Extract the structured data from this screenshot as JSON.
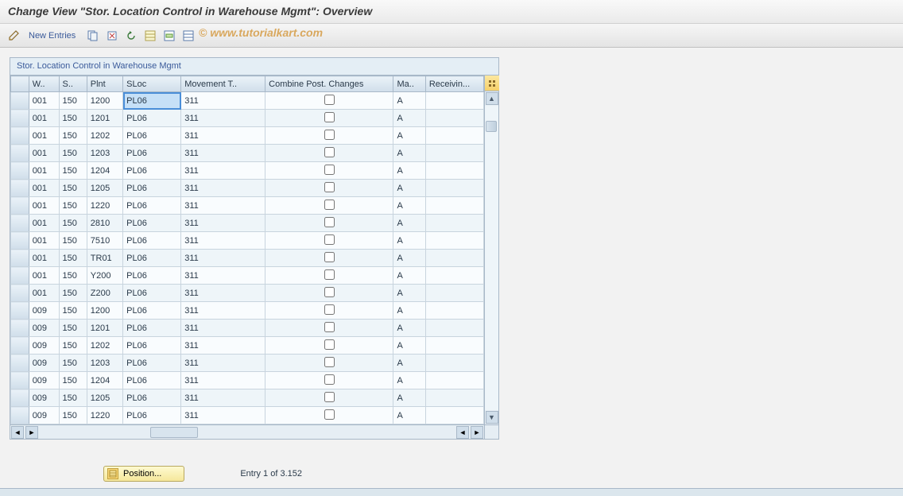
{
  "header": {
    "title": "Change View \"Stor. Location Control in Warehouse Mgmt\": Overview"
  },
  "toolbar": {
    "new_entries": "New Entries"
  },
  "watermark": "© www.tutorialkart.com",
  "panel": {
    "title": "Stor. Location Control in Warehouse Mgmt",
    "columns": {
      "w": "W..",
      "s": "S..",
      "plnt": "Plnt",
      "sloc": "SLoc",
      "movement": "Movement T..",
      "combine": "Combine Post. Changes",
      "ma": "Ma..",
      "receiving": "Receivin..."
    },
    "rows": [
      {
        "w": "001",
        "s": "150",
        "plnt": "1200",
        "sloc": "PL06",
        "mv": "311",
        "combine": false,
        "ma": "A",
        "recv": "",
        "selected": true
      },
      {
        "w": "001",
        "s": "150",
        "plnt": "1201",
        "sloc": "PL06",
        "mv": "311",
        "combine": false,
        "ma": "A",
        "recv": ""
      },
      {
        "w": "001",
        "s": "150",
        "plnt": "1202",
        "sloc": "PL06",
        "mv": "311",
        "combine": false,
        "ma": "A",
        "recv": ""
      },
      {
        "w": "001",
        "s": "150",
        "plnt": "1203",
        "sloc": "PL06",
        "mv": "311",
        "combine": false,
        "ma": "A",
        "recv": ""
      },
      {
        "w": "001",
        "s": "150",
        "plnt": "1204",
        "sloc": "PL06",
        "mv": "311",
        "combine": false,
        "ma": "A",
        "recv": ""
      },
      {
        "w": "001",
        "s": "150",
        "plnt": "1205",
        "sloc": "PL06",
        "mv": "311",
        "combine": false,
        "ma": "A",
        "recv": ""
      },
      {
        "w": "001",
        "s": "150",
        "plnt": "1220",
        "sloc": "PL06",
        "mv": "311",
        "combine": false,
        "ma": "A",
        "recv": ""
      },
      {
        "w": "001",
        "s": "150",
        "plnt": "2810",
        "sloc": "PL06",
        "mv": "311",
        "combine": false,
        "ma": "A",
        "recv": ""
      },
      {
        "w": "001",
        "s": "150",
        "plnt": "7510",
        "sloc": "PL06",
        "mv": "311",
        "combine": false,
        "ma": "A",
        "recv": ""
      },
      {
        "w": "001",
        "s": "150",
        "plnt": "TR01",
        "sloc": "PL06",
        "mv": "311",
        "combine": false,
        "ma": "A",
        "recv": ""
      },
      {
        "w": "001",
        "s": "150",
        "plnt": "Y200",
        "sloc": "PL06",
        "mv": "311",
        "combine": false,
        "ma": "A",
        "recv": ""
      },
      {
        "w": "001",
        "s": "150",
        "plnt": "Z200",
        "sloc": "PL06",
        "mv": "311",
        "combine": false,
        "ma": "A",
        "recv": ""
      },
      {
        "w": "009",
        "s": "150",
        "plnt": "1200",
        "sloc": "PL06",
        "mv": "311",
        "combine": false,
        "ma": "A",
        "recv": ""
      },
      {
        "w": "009",
        "s": "150",
        "plnt": "1201",
        "sloc": "PL06",
        "mv": "311",
        "combine": false,
        "ma": "A",
        "recv": ""
      },
      {
        "w": "009",
        "s": "150",
        "plnt": "1202",
        "sloc": "PL06",
        "mv": "311",
        "combine": false,
        "ma": "A",
        "recv": ""
      },
      {
        "w": "009",
        "s": "150",
        "plnt": "1203",
        "sloc": "PL06",
        "mv": "311",
        "combine": false,
        "ma": "A",
        "recv": ""
      },
      {
        "w": "009",
        "s": "150",
        "plnt": "1204",
        "sloc": "PL06",
        "mv": "311",
        "combine": false,
        "ma": "A",
        "recv": ""
      },
      {
        "w": "009",
        "s": "150",
        "plnt": "1205",
        "sloc": "PL06",
        "mv": "311",
        "combine": false,
        "ma": "A",
        "recv": ""
      },
      {
        "w": "009",
        "s": "150",
        "plnt": "1220",
        "sloc": "PL06",
        "mv": "311",
        "combine": false,
        "ma": "A",
        "recv": ""
      }
    ]
  },
  "footer": {
    "position_label": "Position...",
    "entry_info": "Entry 1 of 3.152"
  }
}
